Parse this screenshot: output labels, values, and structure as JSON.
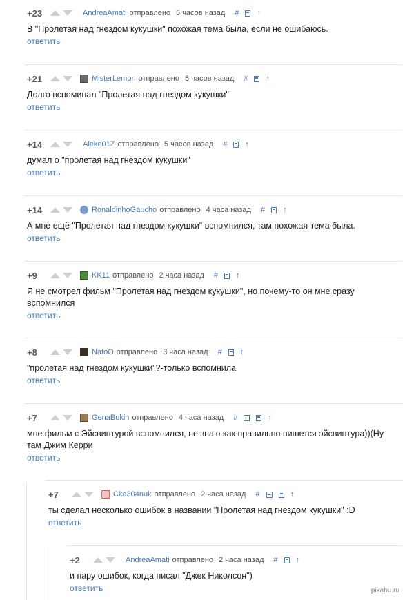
{
  "sent_label": "отправлено",
  "reply_label": "ответить",
  "icons": {
    "hash": "#",
    "save": "save-icon",
    "collapse": "collapse-icon",
    "parent": "↑"
  },
  "comments": [
    {
      "rating": "+23",
      "avatar": "none",
      "author": "AndreaAmati",
      "time": "5 часов назад",
      "collapse": false,
      "text": "В \"Пролетая над гнездом кукушки\" похожая тема была, если не ошибаюсь."
    },
    {
      "rating": "+21",
      "avatar": "gray",
      "author": "MisterLemon",
      "time": "5 часов назад",
      "collapse": false,
      "text": "Долго вспоминал \"Пролетая над гнездом кукушки\""
    },
    {
      "rating": "+14",
      "avatar": "none",
      "author": "Aleke01Z",
      "time": "5 часов назад",
      "collapse": false,
      "text": "думал о \"пролетая над гнездом кукушки\""
    },
    {
      "rating": "+14",
      "avatar": "blue",
      "author": "RonaldinhoGaucho",
      "time": "4 часа назад",
      "collapse": false,
      "text": "А мне ещё \"Пролетая над гнездом кукушки\" вспомнился, там похожая тема была."
    },
    {
      "rating": "+9",
      "avatar": "green",
      "author": "KK11",
      "time": "2 часа назад",
      "collapse": false,
      "text": "Я не смотрел фильм \"Пролетая над гнездом кукушки\", но почему-то он мне сразу вспомнился"
    },
    {
      "rating": "+8",
      "avatar": "dark",
      "author": "NatoO",
      "time": "3 часа назад",
      "collapse": false,
      "text": "\"пролетая над гнездом кукушки\"?-только вспомнила"
    },
    {
      "rating": "+7",
      "avatar": "brown",
      "author": "GenaBukin",
      "time": "4 часа назад",
      "collapse": true,
      "text": "мне фильм с Эйсвинтурой вспомнился, не знаю как правильно пишется эйсвинтура))(Ну там Джим Керри"
    },
    {
      "rating": "+7",
      "avatar": "red",
      "author": "Cka304nuk",
      "time": "2 часа назад",
      "collapse": true,
      "text": "ты сделал несколько ошибок в названии \"Пролетая над гнездом кукушки\" :D"
    },
    {
      "rating": "+2",
      "avatar": "none",
      "author": "AndreaAmati",
      "time": "2 часа назад",
      "collapse": false,
      "text": "и пару ошибок, когда писал \"Джек Николсон\")"
    }
  ],
  "watermark": "pikabu.ru"
}
